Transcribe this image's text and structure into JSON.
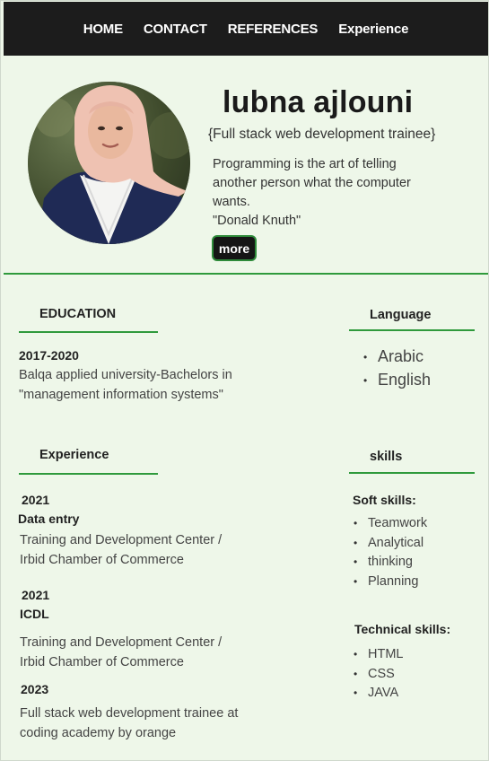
{
  "nav": {
    "items": [
      "HOME",
      "CONTACT",
      "REFERENCES",
      "Experience"
    ]
  },
  "profile": {
    "name": "lubna ajlouni",
    "role": "{Full stack web development trainee}",
    "quote_lines": [
      "Programming is the art of telling",
      "another person what the computer",
      "wants.",
      "\"Donald Knuth\""
    ],
    "more_label": "more"
  },
  "education": {
    "title": "EDUCATION",
    "years": "2017-2020",
    "lines": [
      "Balqa applied university-Bachelors in",
      "\"management information systems\""
    ]
  },
  "language": {
    "title": "Language",
    "items": [
      "Arabic",
      "English"
    ]
  },
  "experience": {
    "title": "Experience",
    "entries": [
      {
        "year": "2021",
        "role": "Data entry",
        "lines": [
          "Training and Development Center /",
          "Irbid Chamber of Commerce"
        ]
      },
      {
        "year": "2021",
        "role": "ICDL",
        "lines": [
          "Training and Development Center /",
          "Irbid Chamber of Commerce"
        ]
      },
      {
        "year": "2023",
        "lines": [
          "Full stack web development trainee at",
          "coding academy by orange"
        ]
      }
    ]
  },
  "skills": {
    "title": "skills",
    "soft_title": "Soft skills:",
    "soft": [
      "Teamwork",
      "Analytical",
      "thinking",
      "Planning"
    ],
    "tech_title": "Technical skills:",
    "tech": [
      "HTML",
      "CSS",
      "JAVA"
    ]
  }
}
